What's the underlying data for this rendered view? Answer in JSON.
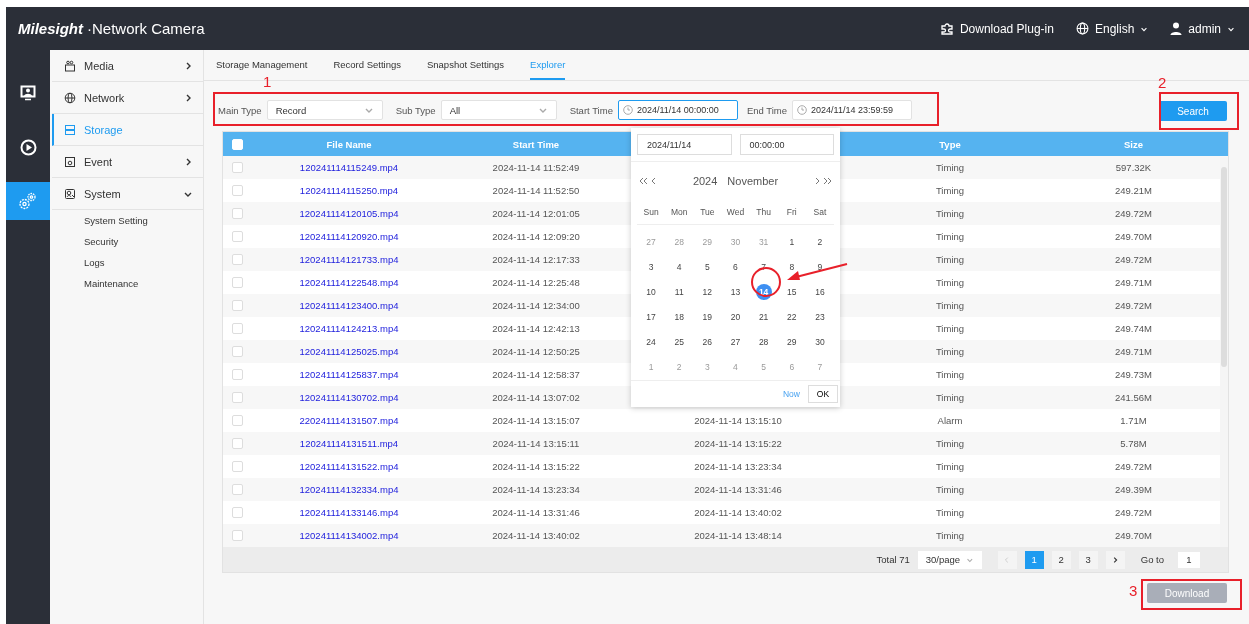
{
  "header": {
    "brand": "Milesight",
    "separator": "·",
    "product": "Network Camera",
    "plugin": "Download Plug-in",
    "language": "English",
    "user": "admin"
  },
  "rail": [
    {
      "kind": "live",
      "selected": false
    },
    {
      "kind": "playback",
      "selected": false
    },
    {
      "kind": "settings",
      "selected": true
    }
  ],
  "sidebar": {
    "items": [
      {
        "label": "Media",
        "kind": "group",
        "expanded": false,
        "selected": false
      },
      {
        "label": "Network",
        "kind": "group",
        "expanded": false,
        "selected": false
      },
      {
        "label": "Storage",
        "kind": "leaf",
        "expanded": false,
        "selected": true
      },
      {
        "label": "Event",
        "kind": "group",
        "expanded": false,
        "selected": false
      },
      {
        "label": "System",
        "kind": "group",
        "expanded": true,
        "selected": false,
        "children": [
          {
            "label": "System Setting"
          },
          {
            "label": "Security"
          },
          {
            "label": "Logs"
          },
          {
            "label": "Maintenance"
          }
        ]
      }
    ]
  },
  "tabs": [
    {
      "label": "Storage Management",
      "selected": false
    },
    {
      "label": "Record Settings",
      "selected": false
    },
    {
      "label": "Snapshot Settings",
      "selected": false
    },
    {
      "label": "Explorer",
      "selected": true
    }
  ],
  "filters": {
    "main_type": {
      "label": "Main Type",
      "value": "Record"
    },
    "sub_type": {
      "label": "Sub Type",
      "value": "All"
    },
    "start_time": {
      "label": "Start Time",
      "value": "2024/11/14 00:00:00",
      "focused": true
    },
    "end_time": {
      "label": "End Time",
      "value": "2024/11/14 23:59:59",
      "focused": false
    }
  },
  "search_button": "Search",
  "table": {
    "columns": {
      "file_name": "File Name",
      "start_time": "Start Time",
      "type": "Type",
      "size": "Size"
    },
    "header_checked": false,
    "rows": [
      {
        "file": "120241114115249.mp4",
        "start": "2024-11-14 11:52:49",
        "type": "Timing",
        "size": "597.32K",
        "checked": false
      },
      {
        "file": "120241114115250.mp4",
        "start": "2024-11-14 11:52:50",
        "type": "Timing",
        "size": "249.21M",
        "checked": false
      },
      {
        "file": "120241114120105.mp4",
        "start": "2024-11-14 12:01:05",
        "type": "Timing",
        "size": "249.72M",
        "checked": false
      },
      {
        "file": "120241114120920.mp4",
        "start": "2024-11-14 12:09:20",
        "type": "Timing",
        "size": "249.70M",
        "checked": false
      },
      {
        "file": "120241114121733.mp4",
        "start": "2024-11-14 12:17:33",
        "type": "Timing",
        "size": "249.72M",
        "checked": false
      },
      {
        "file": "120241114122548.mp4",
        "start": "2024-11-14 12:25:48",
        "type": "Timing",
        "size": "249.71M",
        "checked": false
      },
      {
        "file": "120241114123400.mp4",
        "start": "2024-11-14 12:34:00",
        "type": "Timing",
        "size": "249.72M",
        "checked": false
      },
      {
        "file": "120241114124213.mp4",
        "start": "2024-11-14 12:42:13",
        "type": "Timing",
        "size": "249.74M",
        "checked": false
      },
      {
        "file": "120241114125025.mp4",
        "start": "2024-11-14 12:50:25",
        "type": "Timing",
        "size": "249.71M",
        "checked": false
      },
      {
        "file": "120241114125837.mp4",
        "start": "2024-11-14 12:58:37",
        "type": "Timing",
        "size": "249.73M",
        "checked": false
      },
      {
        "file": "120241114130702.mp4",
        "start": "2024-11-14 13:07:02",
        "type": "Timing",
        "size": "241.56M",
        "checked": false
      },
      {
        "file": "220241114131507.mp4",
        "start": "2024-11-14 13:15:07",
        "end": "2024-11-14 13:15:10",
        "type": "Alarm",
        "size": "1.71M",
        "checked": false
      },
      {
        "file": "120241114131511.mp4",
        "start": "2024-11-14 13:15:11",
        "end": "2024-11-14 13:15:22",
        "type": "Timing",
        "size": "5.78M",
        "checked": false
      },
      {
        "file": "120241114131522.mp4",
        "start": "2024-11-14 13:15:22",
        "end": "2024-11-14 13:23:34",
        "type": "Timing",
        "size": "249.72M",
        "checked": false
      },
      {
        "file": "120241114132334.mp4",
        "start": "2024-11-14 13:23:34",
        "end": "2024-11-14 13:31:46",
        "type": "Timing",
        "size": "249.39M",
        "checked": false
      },
      {
        "file": "120241114133146.mp4",
        "start": "2024-11-14 13:31:46",
        "end": "2024-11-14 13:40:02",
        "type": "Timing",
        "size": "249.72M",
        "checked": false
      },
      {
        "file": "120241114134002.mp4",
        "start": "2024-11-14 13:40:02",
        "end": "2024-11-14 13:48:14",
        "type": "Timing",
        "size": "249.70M",
        "checked": false
      }
    ]
  },
  "pagination": {
    "total": "Total 71",
    "page_size": "30/page",
    "pages": [
      {
        "label": "1",
        "selected": true
      },
      {
        "label": "2",
        "selected": false
      },
      {
        "label": "3",
        "selected": false
      }
    ],
    "goto_label": "Go to",
    "goto_value": "1"
  },
  "download_button": {
    "label": "Download",
    "disabled": true
  },
  "date_picker": {
    "date": "2024/11/14",
    "time": "00:00:00",
    "year": "2024",
    "month": "November",
    "weekdays": [
      "Sun",
      "Mon",
      "Tue",
      "Wed",
      "Thu",
      "Fri",
      "Sat"
    ],
    "days": [
      {
        "label": "27",
        "muted": true,
        "selected": false
      },
      {
        "label": "28",
        "muted": true,
        "selected": false
      },
      {
        "label": "29",
        "muted": true,
        "selected": false
      },
      {
        "label": "30",
        "muted": true,
        "selected": false
      },
      {
        "label": "31",
        "muted": true,
        "selected": false
      },
      {
        "label": "1",
        "muted": false,
        "selected": false
      },
      {
        "label": "2",
        "muted": false,
        "selected": false
      },
      {
        "label": "3",
        "muted": false,
        "selected": false
      },
      {
        "label": "4",
        "muted": false,
        "selected": false
      },
      {
        "label": "5",
        "muted": false,
        "selected": false
      },
      {
        "label": "6",
        "muted": false,
        "selected": false
      },
      {
        "label": "7",
        "muted": false,
        "selected": false
      },
      {
        "label": "8",
        "muted": false,
        "selected": false
      },
      {
        "label": "9",
        "muted": false,
        "selected": false
      },
      {
        "label": "10",
        "muted": false,
        "selected": false
      },
      {
        "label": "11",
        "muted": false,
        "selected": false
      },
      {
        "label": "12",
        "muted": false,
        "selected": false
      },
      {
        "label": "13",
        "muted": false,
        "selected": false
      },
      {
        "label": "14",
        "muted": false,
        "selected": true
      },
      {
        "label": "15",
        "muted": false,
        "selected": false
      },
      {
        "label": "16",
        "muted": false,
        "selected": false
      },
      {
        "label": "17",
        "muted": false,
        "selected": false
      },
      {
        "label": "18",
        "muted": false,
        "selected": false
      },
      {
        "label": "19",
        "muted": false,
        "selected": false
      },
      {
        "label": "20",
        "muted": false,
        "selected": false
      },
      {
        "label": "21",
        "muted": false,
        "selected": false
      },
      {
        "label": "22",
        "muted": false,
        "selected": false
      },
      {
        "label": "23",
        "muted": false,
        "selected": false
      },
      {
        "label": "24",
        "muted": false,
        "selected": false
      },
      {
        "label": "25",
        "muted": false,
        "selected": false
      },
      {
        "label": "26",
        "muted": false,
        "selected": false
      },
      {
        "label": "27",
        "muted": false,
        "selected": false
      },
      {
        "label": "28",
        "muted": false,
        "selected": false
      },
      {
        "label": "29",
        "muted": false,
        "selected": false
      },
      {
        "label": "30",
        "muted": false,
        "selected": false
      },
      {
        "label": "1",
        "muted": true,
        "selected": false
      },
      {
        "label": "2",
        "muted": true,
        "selected": false
      },
      {
        "label": "3",
        "muted": true,
        "selected": false
      },
      {
        "label": "4",
        "muted": true,
        "selected": false
      },
      {
        "label": "5",
        "muted": true,
        "selected": false
      },
      {
        "label": "6",
        "muted": true,
        "selected": false
      },
      {
        "label": "7",
        "muted": true,
        "selected": false
      }
    ],
    "now": "Now",
    "ok": "OK"
  },
  "annotations": [
    {
      "label": "1"
    },
    {
      "label": "2"
    },
    {
      "label": "3"
    }
  ]
}
